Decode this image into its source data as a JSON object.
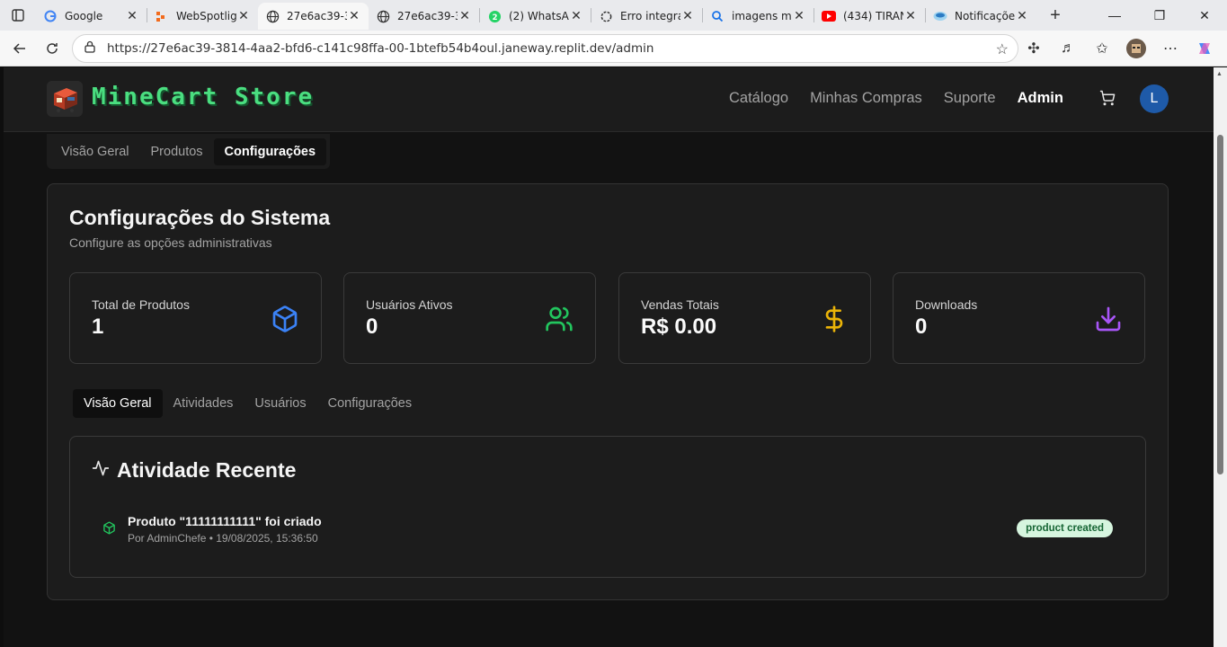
{
  "browser": {
    "tabs": [
      {
        "title": "Google",
        "icon": "google-icon"
      },
      {
        "title": "WebSpotlig",
        "icon": "webspotlight-icon"
      },
      {
        "title": "27e6ac39-3",
        "icon": "globe-icon",
        "active": true
      },
      {
        "title": "27e6ac39-3",
        "icon": "globe-icon"
      },
      {
        "title": "(2) WhatsAp",
        "icon": "whatsapp-icon"
      },
      {
        "title": "Erro integra",
        "icon": "openai-icon"
      },
      {
        "title": "imagens mi",
        "icon": "search-icon"
      },
      {
        "title": "(434) TIRAN",
        "icon": "youtube-icon"
      },
      {
        "title": "Notificaçõe",
        "icon": "notifications-icon"
      }
    ],
    "url": "https://27e6ac39-3814-4aa2-bfd6-c141c98ffa-00-1btefb54b4oul.janeway.replit.dev/admin"
  },
  "header": {
    "brand": "MineCart Store",
    "nav": [
      "Catálogo",
      "Minhas Compras",
      "Suporte",
      "Admin"
    ],
    "avatar_initial": "L"
  },
  "admin_tabs": [
    "Visão Geral",
    "Produtos",
    "Configurações"
  ],
  "settings": {
    "title": "Configurações do Sistema",
    "subtitle": "Configure as opções administrativas",
    "stats": [
      {
        "label": "Total de Produtos",
        "value": "1",
        "icon": "box-icon",
        "color": "#3b82f6"
      },
      {
        "label": "Usuários Ativos",
        "value": "0",
        "icon": "users-icon",
        "color": "#22c55e"
      },
      {
        "label": "Vendas Totais",
        "value": "R$ 0.00",
        "icon": "dollar-icon",
        "color": "#eab308"
      },
      {
        "label": "Downloads",
        "value": "0",
        "icon": "download-icon",
        "color": "#a855f7"
      }
    ],
    "sub_tabs": [
      "Visão Geral",
      "Atividades",
      "Usuários",
      "Configurações"
    ],
    "activity": {
      "title": "Atividade Recente",
      "items": [
        {
          "title": "Produto \"11111111111\" foi criado",
          "meta": "Por AdminChefe • 19/08/2025, 15:36:50",
          "badge": "product created"
        }
      ]
    }
  }
}
